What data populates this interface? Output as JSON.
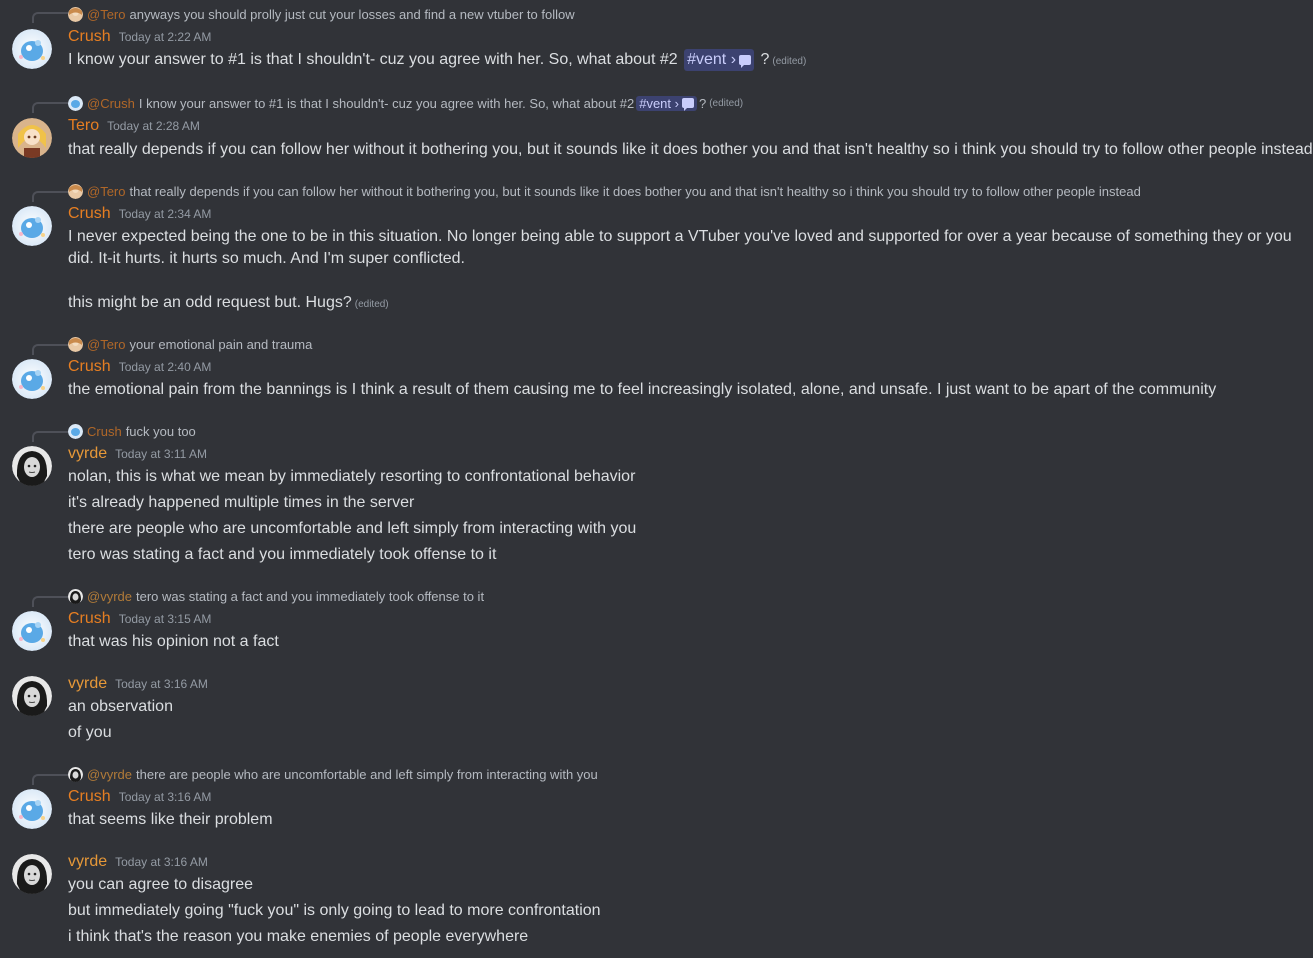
{
  "messages": [
    {
      "reply": {
        "name": "@Tero",
        "text": "anyways you should prolly just cut your losses and find a new vtuber to follow"
      },
      "author": "Crush",
      "time": "Today at 2:22 AM",
      "line": {
        "a": "I know your answer to #1 is that I shouldn't- cuz you agree with her. So, what about #2",
        "channel": "vent",
        "b": "?",
        "edited": "(edited)"
      }
    },
    {
      "reply": {
        "name": "@Crush",
        "a": "I know your answer to #1 is that I shouldn't- cuz you agree with her. So, what about #2",
        "channel": "vent",
        "b": "?",
        "edited": "(edited)"
      },
      "author": "Tero",
      "time": "Today at 2:28 AM",
      "lines": [
        "that really depends if you can follow her without it bothering you, but it sounds like it does bother you and that isn't healthy so i think you should try to follow other people instead"
      ]
    },
    {
      "reply": {
        "name": "@Tero",
        "text": "that really depends if you can follow her without it bothering you, but it sounds like it does bother you and that isn't healthy so i think you should try to follow other people instead"
      },
      "author": "Crush",
      "time": "Today at 2:34 AM",
      "lines": [
        "I never expected being the one to be in this situation. No longer being able to support a VTuber you've loved and supported for over a year because of something they or you did. It-it hurts. it hurts so much. And I'm super conflicted."
      ],
      "extra": {
        "text": "this might be an odd request but. Hugs?",
        "edited": "(edited)"
      }
    },
    {
      "reply": {
        "name": "@Tero",
        "text": "your emotional pain and trauma"
      },
      "author": "Crush",
      "time": "Today at 2:40 AM",
      "lines": [
        "the emotional pain from the bannings is I think a result of them causing me to feel increasingly isolated, alone, and unsafe. I just want to be apart of the community"
      ]
    },
    {
      "reply": {
        "name": "Crush",
        "text": "fuck you too"
      },
      "author": "vyrde",
      "time": "Today at 3:11 AM",
      "lines": [
        "nolan, this is what we mean by immediately resorting to confrontational behavior",
        "it's already happened multiple times in the server",
        "there are people who are uncomfortable and left simply from interacting with you",
        "tero was stating a fact and you immediately took offense to it"
      ]
    },
    {
      "reply": {
        "name": "@vyrde",
        "text": "tero was stating a fact and you immediately took offense to it"
      },
      "author": "Crush",
      "time": "Today at 3:15 AM",
      "lines": [
        "that was his opinion not a fact"
      ]
    },
    {
      "author": "vyrde",
      "time": "Today at 3:16 AM",
      "lines": [
        "an observation",
        "of you"
      ]
    },
    {
      "reply": {
        "name": "@vyrde",
        "text": "there are people who are uncomfortable and left simply from interacting with you"
      },
      "author": "Crush",
      "time": "Today at 3:16 AM",
      "lines": [
        "that seems like their problem"
      ]
    },
    {
      "author": "vyrde",
      "time": "Today at 3:16 AM",
      "lines": [
        "you can agree to disagree",
        "but immediately going \"fuck you\" is only going to lead to more confrontation",
        "i think that's the reason you make enemies of people everywhere"
      ]
    }
  ],
  "icons": {
    "channel": "#",
    "chevron": "›",
    "thread": "speech-bubble-icon"
  },
  "colors": {
    "background": "#313338",
    "crush": "#e67e22",
    "tero": "#e67e22",
    "vyrde": "#e69838",
    "mention": "#3c4270"
  }
}
